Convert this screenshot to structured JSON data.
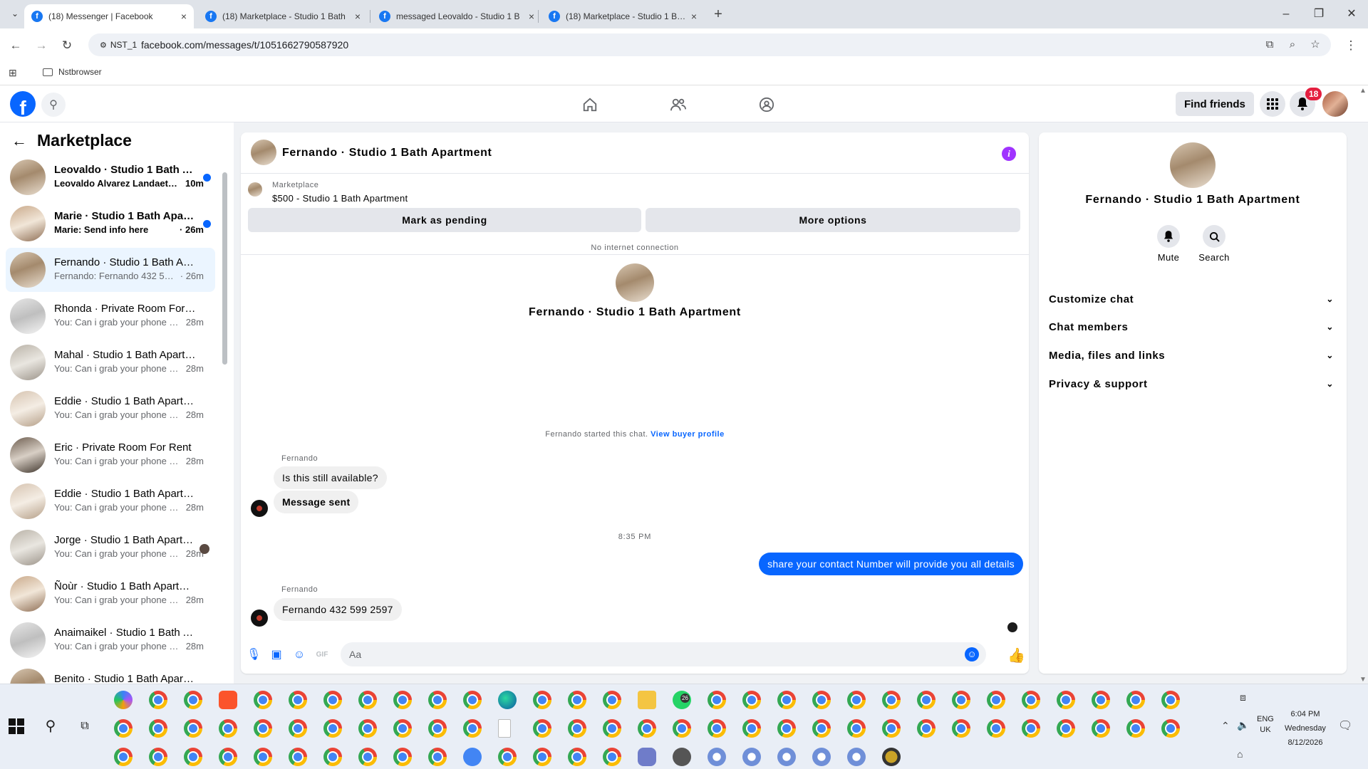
{
  "browser": {
    "tabs": [
      {
        "title": "(18) Messenger | Facebook",
        "active": true
      },
      {
        "title": "(18) Marketplace - Studio 1 Bath",
        "active": false
      },
      {
        "title": "messaged Leovaldo - Studio 1 B",
        "active": false
      },
      {
        "title": "(18) Marketplace - Studio 1 Bath",
        "active": false
      }
    ],
    "site_chip": "NST_1",
    "url": "facebook.com/messages/t/1051662790587920",
    "bookmark": "Nstbrowser"
  },
  "fb": {
    "find_friends": "Find friends",
    "notification_count": "18"
  },
  "sidebar": {
    "title": "Marketplace",
    "conversations": [
      {
        "name": "Leovaldo · Studio 1 Bath Apartment",
        "preview": "Leovaldo Alvarez Landaeta sent",
        "time": "10m",
        "unread": true,
        "thumb": "av-room1"
      },
      {
        "name": "Marie · Studio 1 Bath Apartment",
        "preview": "Marie: Send info here",
        "time": "· 26m",
        "unread": true,
        "thumb": "av-room2"
      },
      {
        "name": "Fernando · Studio 1 Bath Apartment",
        "preview": "Fernando: Fernando 432 599 2597",
        "time": "· 26m",
        "unread": false,
        "active": true,
        "thumb": "av-room1"
      },
      {
        "name": "Rhonda · Private Room For Rent",
        "preview": "You: Can i grab your phone number",
        "time": "28m",
        "unread": false,
        "thumb": "av-room3"
      },
      {
        "name": "Mahal · Studio 1 Bath Apartment",
        "preview": "You: Can i grab your phone number",
        "time": "28m",
        "unread": false,
        "thumb": "av-room4"
      },
      {
        "name": "Eddie · Studio 1 Bath Apartment",
        "preview": "You: Can i grab your phone number",
        "time": "28m",
        "unread": false,
        "thumb": "av-room6"
      },
      {
        "name": "Eric · Private Room For Rent",
        "preview": "You: Can i grab your phone number",
        "time": "28m",
        "unread": false,
        "thumb": "av-room5"
      },
      {
        "name": "Eddie · Studio 1 Bath Apartment",
        "preview": "You: Can i grab your phone number",
        "time": "28m",
        "unread": false,
        "thumb": "av-room6"
      },
      {
        "name": "Jorge · Studio 1 Bath Apartment",
        "preview": "You: Can i grab your phone number",
        "time": "28m",
        "unread": false,
        "seen": true,
        "thumb": "av-room4"
      },
      {
        "name": "Ñoùr · Studio 1 Bath Apartment",
        "preview": "You: Can i grab your phone number",
        "time": "28m",
        "unread": false,
        "thumb": "av-room2"
      },
      {
        "name": "Anaimaikel · Studio 1 Bath Apartment",
        "preview": "You: Can i grab your phone number",
        "time": "28m",
        "unread": false,
        "thumb": "av-room3"
      },
      {
        "name": "Benito · Studio 1 Bath Apartment",
        "preview": "",
        "time": "",
        "unread": false,
        "thumb": "av-room1"
      }
    ]
  },
  "chat": {
    "title": "Fernando · Studio 1 Bath Apartment",
    "marketplace_label": "Marketplace",
    "listing": "$500 - Studio 1 Bath Apartment",
    "mark_pending": "Mark as pending",
    "more_options": "More options",
    "no_internet": "No internet connection",
    "intro_name": "Fernando · Studio 1 Bath Apartment",
    "started_text": "Fernando started this chat.",
    "view_buyer": "View buyer profile",
    "sender1": "Fernando",
    "msg1": "Is this still available?",
    "msg2": "Message sent",
    "time_sep": "8:35 PM",
    "msg_out": "share your contact Number will provide you all details",
    "sender2": "Fernando",
    "msg3": "Fernando 432 599 2597",
    "composer_placeholder": "Aa"
  },
  "details": {
    "name": "Fernando · Studio 1 Bath Apartment",
    "mute": "Mute",
    "search": "Search",
    "sections": [
      "Customize chat",
      "Chat members",
      "Media, files and links",
      "Privacy & support"
    ]
  },
  "taskbar": {
    "time": "6:04 PM",
    "day": "Wednesday",
    "date": "8/12/2026",
    "lang1": "ENG",
    "lang2": "UK",
    "whatsapp_count": "26"
  }
}
